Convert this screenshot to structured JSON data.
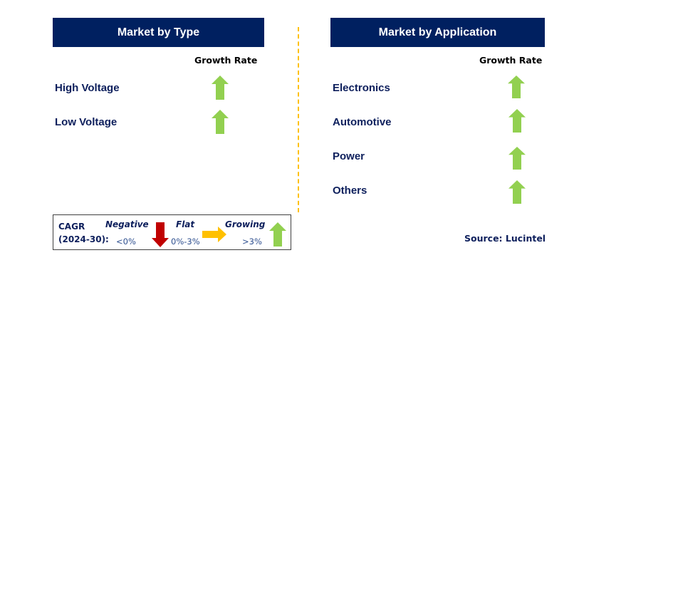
{
  "type_panel": {
    "title": "Market by Type",
    "growth_header": "Growth Rate",
    "items": [
      {
        "label": "High Voltage",
        "trend": "growing"
      },
      {
        "label": "Low Voltage",
        "trend": "growing"
      }
    ]
  },
  "application_panel": {
    "title": "Market by Application",
    "growth_header": "Growth Rate",
    "items": [
      {
        "label": "Electronics",
        "trend": "growing"
      },
      {
        "label": "Automotive",
        "trend": "growing"
      },
      {
        "label": "Power",
        "trend": "growing"
      },
      {
        "label": "Others",
        "trend": "growing"
      }
    ]
  },
  "legend": {
    "cagr_label": "CAGR",
    "period_label": "(2024-30):",
    "negative": {
      "label": "Negative",
      "range": "<0%",
      "icon": "down-arrow-icon",
      "color": "#c00000"
    },
    "flat": {
      "label": "Flat",
      "range": "0%-3%",
      "icon": "right-arrow-icon",
      "color": "#ffc000"
    },
    "growing": {
      "label": "Growing",
      "range": ">3%",
      "icon": "up-arrow-icon",
      "color": "#92d050"
    }
  },
  "source": "Source: Lucintel",
  "colors": {
    "header_bg": "#002060",
    "label_text": "#0d1f5c",
    "divider": "#ffc000"
  }
}
